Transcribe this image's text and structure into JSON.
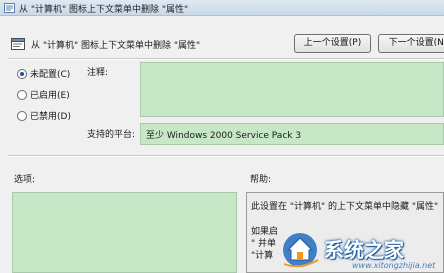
{
  "window": {
    "title": "从 \"计算机\" 图标上下文菜单中删除 \"属性\"",
    "icon": "policy-settings-icon"
  },
  "header": {
    "title": "从 \"计算机\" 图标上下文菜单中删除 \"属性\"",
    "icon": "policy-settings-icon",
    "prev_button": "上一个设置(P)",
    "next_button": "下一个设置(N)"
  },
  "state": {
    "options": [
      {
        "label": "未配置(C)",
        "checked": true
      },
      {
        "label": "已启用(E)",
        "checked": false
      },
      {
        "label": "已禁用(D)",
        "checked": false
      }
    ]
  },
  "comment": {
    "label": "注释:",
    "value": ""
  },
  "platform": {
    "label": "支持的平台:",
    "value": "至少 Windows 2000 Service Pack 3"
  },
  "options_section": {
    "label": "选项:"
  },
  "help_section": {
    "label": "帮助:",
    "lines": [
      "此设置在 \"计算机\" 的上下文菜单中隐藏 \"属性\"",
      "如果启",
      "\" 并单",
      "\"计算"
    ]
  },
  "watermark": {
    "name": "系统之家",
    "url": "www.xitongzhijia.net"
  },
  "colors": {
    "field_green": "#c6e8c7",
    "accent": "#1b4fa0"
  }
}
